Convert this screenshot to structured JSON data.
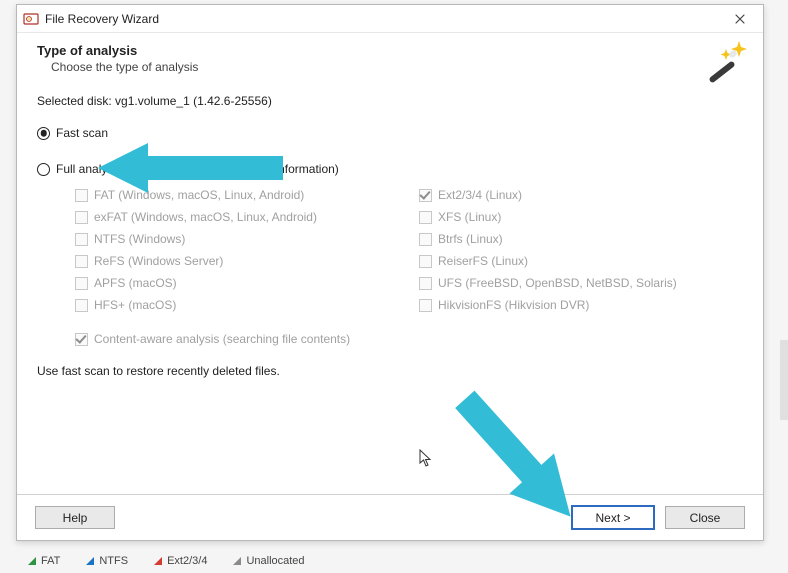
{
  "window": {
    "title": "File Recovery Wizard"
  },
  "header": {
    "heading": "Type of analysis",
    "subheading": "Choose the type of analysis"
  },
  "selectedDisk": "Selected disk: vg1.volume_1 (1.42.6-25556)",
  "options": {
    "fast": "Fast scan",
    "full": "Full analysis (searching for any available information)"
  },
  "filesystems": {
    "left": [
      "FAT (Windows, macOS, Linux, Android)",
      "exFAT (Windows, macOS, Linux, Android)",
      "NTFS (Windows)",
      "ReFS (Windows Server)",
      "APFS (macOS)",
      "HFS+ (macOS)"
    ],
    "right": [
      "Ext2/3/4 (Linux)",
      "XFS (Linux)",
      "Btrfs (Linux)",
      "ReiserFS (Linux)",
      "UFS (FreeBSD, OpenBSD, NetBSD, Solaris)",
      "HikvisionFS (Hikvision DVR)"
    ]
  },
  "contentAware": "Content-aware analysis (searching file contents)",
  "hint": "Use fast scan to restore recently deleted files.",
  "buttons": {
    "help": "Help",
    "next": "Next >",
    "close": "Close"
  },
  "legend": {
    "fat": "FAT",
    "ntfs": "NTFS",
    "ext": "Ext2/3/4",
    "unallocated": "Unallocated"
  },
  "colors": {
    "arrow": "#32bcd6",
    "primaryBorder": "#2c6bbf"
  }
}
